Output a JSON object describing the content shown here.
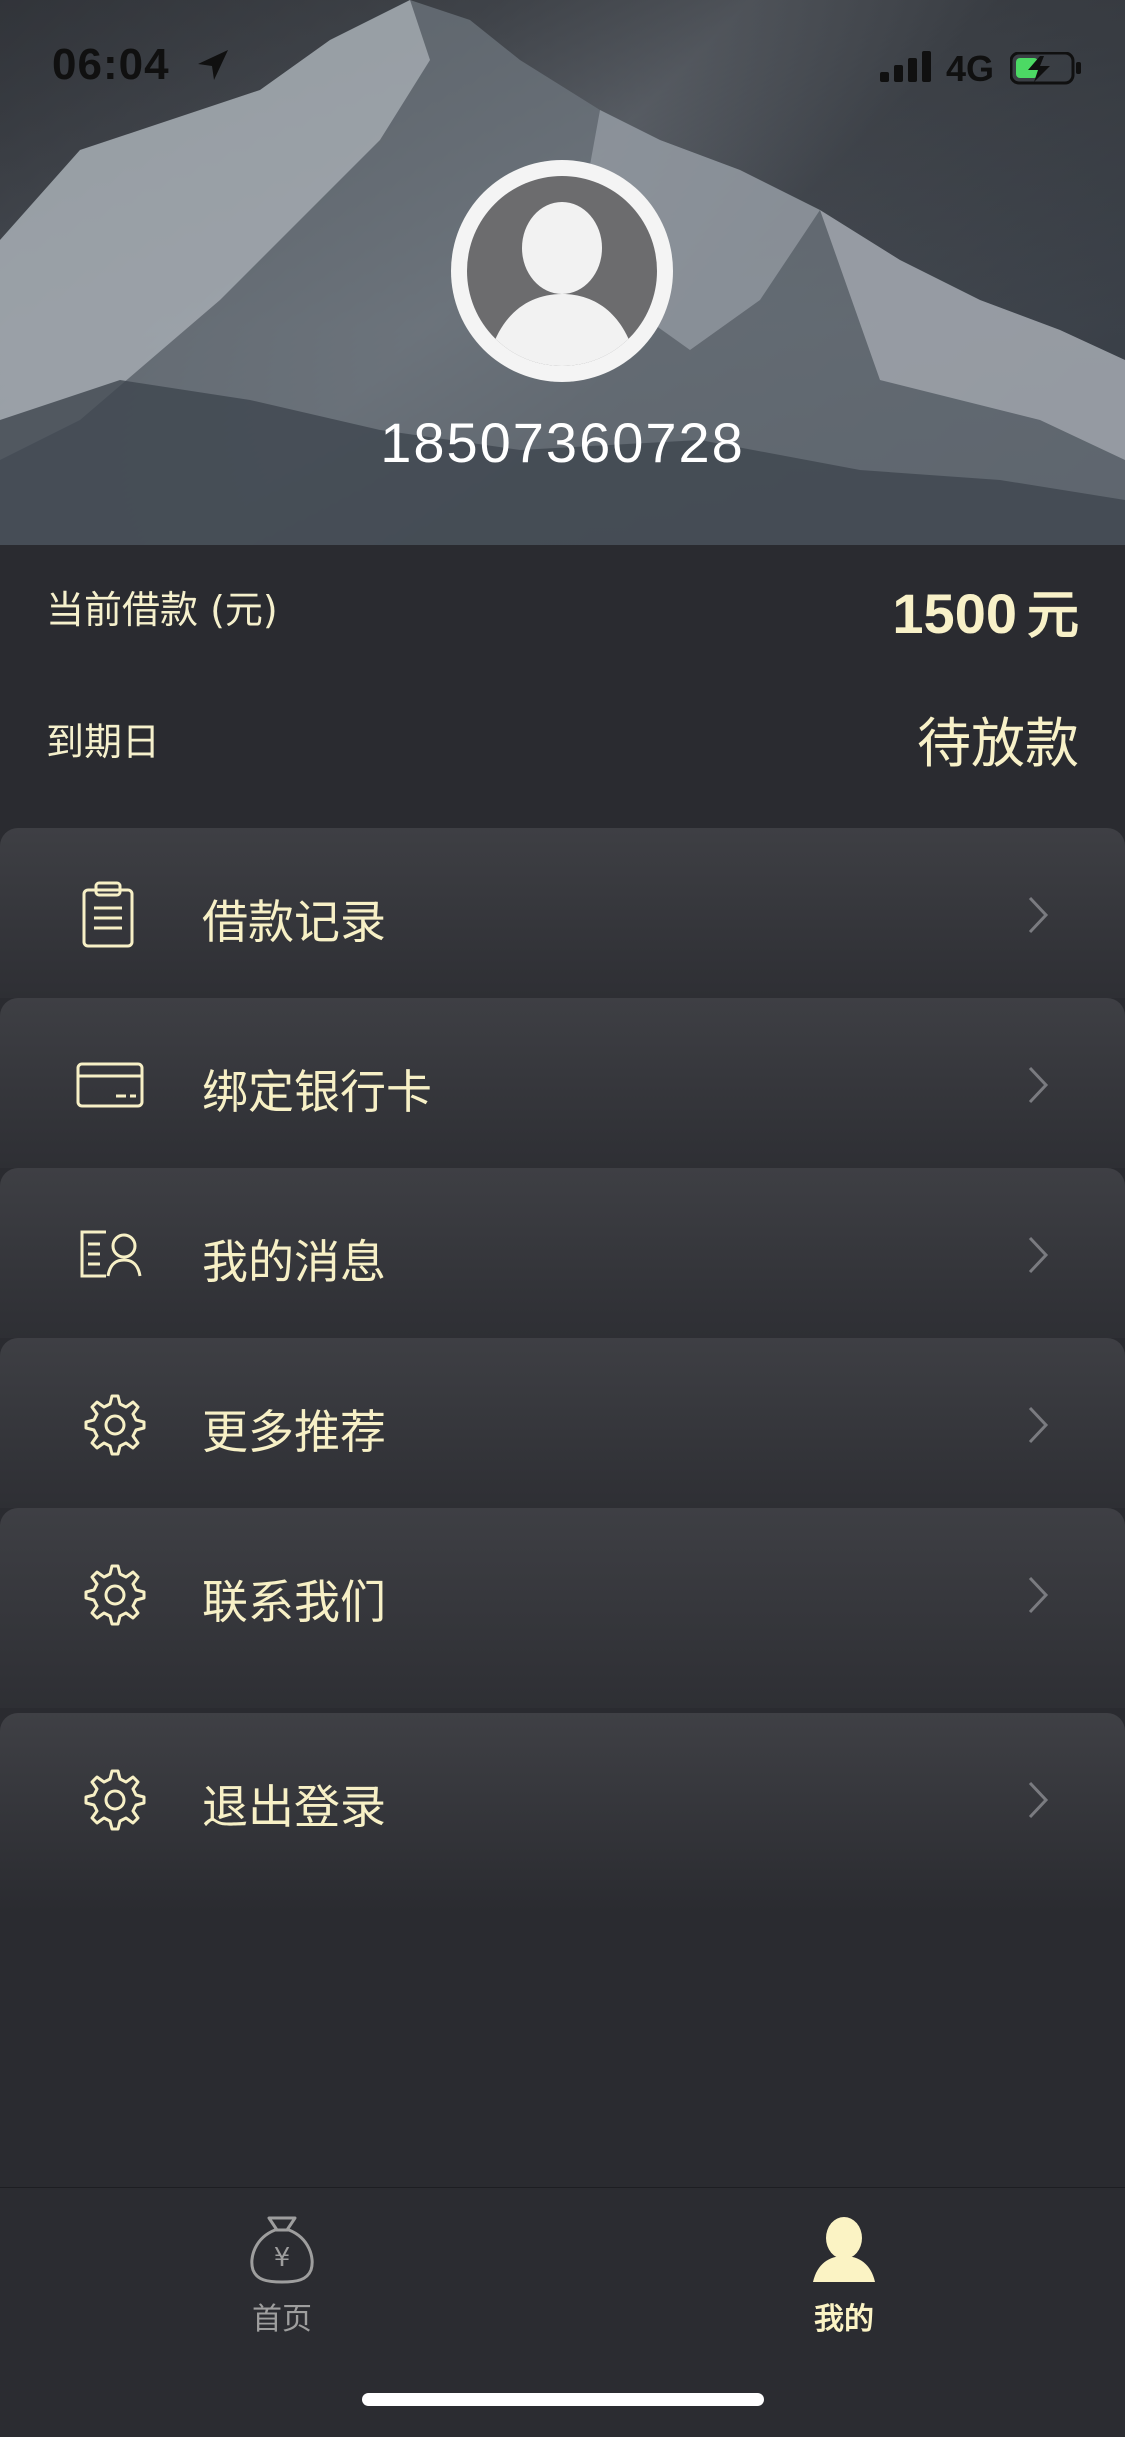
{
  "status": {
    "time": "06:04",
    "network": "4G",
    "icons": [
      "location-arrow-icon",
      "signal-icon",
      "battery-charging-icon"
    ]
  },
  "profile": {
    "phone": "18507360728",
    "avatar_icon": "user-silhouette-icon"
  },
  "loan": {
    "current_label": "当前借款 (元)",
    "current_amount": "1500",
    "current_unit": "元",
    "due_label": "到期日",
    "due_value": "待放款"
  },
  "menu": {
    "items": [
      {
        "label": "借款记录",
        "icon": "clipboard-icon"
      },
      {
        "label": "绑定银行卡",
        "icon": "bank-card-icon"
      },
      {
        "label": "我的消息",
        "icon": "contact-card-icon"
      },
      {
        "label": "更多推荐",
        "icon": "gear-icon"
      },
      {
        "label": "联系我们",
        "icon": "gear-icon"
      },
      {
        "label": "退出登录",
        "icon": "gear-icon"
      }
    ]
  },
  "tabbar": {
    "home_label": "首页",
    "me_label": "我的",
    "home_icon": "money-bag-icon",
    "me_icon": "person-icon"
  },
  "colors": {
    "accent": "#f7f0c6",
    "background": "#2a2b30",
    "inactive": "#9e9e9e"
  }
}
